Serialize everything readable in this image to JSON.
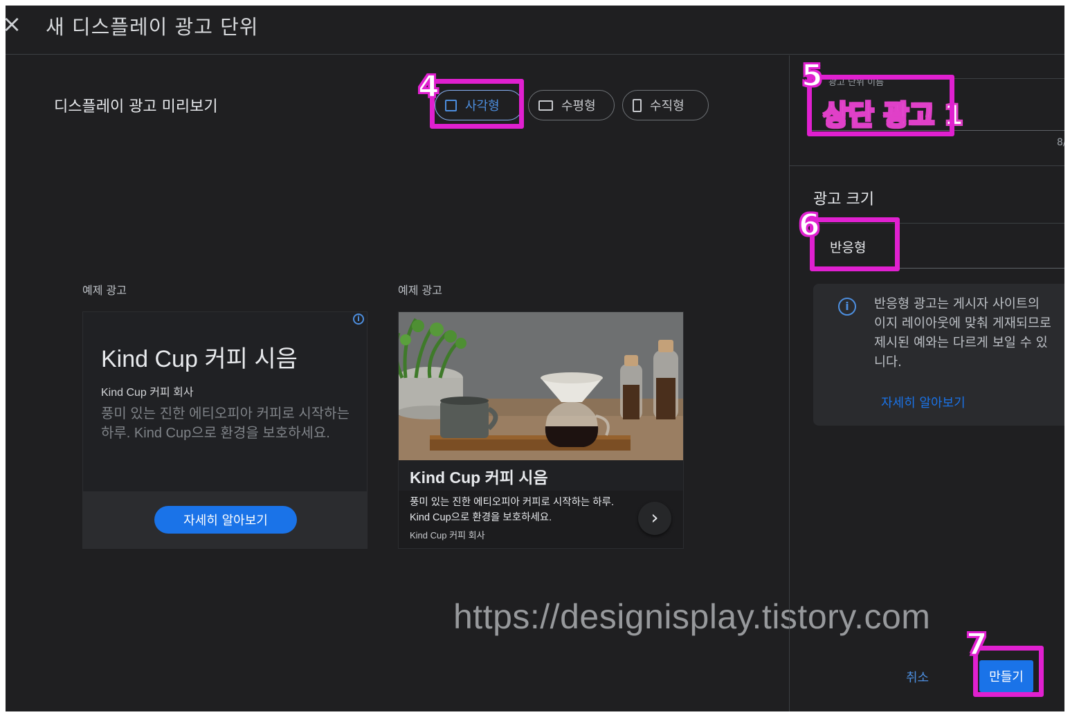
{
  "header": {
    "close_icon": "×",
    "title": "새 디스플레이 광고 단위"
  },
  "preview": {
    "title": "디스플레이 광고 미리보기",
    "shapes": [
      {
        "label": "사각형",
        "icon": "square-icon",
        "active": true
      },
      {
        "label": "수평형",
        "icon": "horizontal-rect-icon",
        "active": false
      },
      {
        "label": "수직형",
        "icon": "vertical-rect-icon",
        "active": false
      }
    ],
    "sample_label": "예제 광고",
    "ad_text": {
      "headline": "Kind Cup 커피 시음",
      "company": "Kind Cup 커피 회사",
      "description": "풍미 있는 진한 에티오피아 커피로 시작하는 하루. Kind Cup으로 환경을 보호하세요.",
      "cta": "자세히 알아보기",
      "adchoices_icon": "i"
    },
    "ad_image": {
      "arrow": "›"
    }
  },
  "settings": {
    "name_label": "광고 단위 이름",
    "name_value": "상단 광고 1",
    "name_counter": "8/",
    "size_title": "광고 크기",
    "size_value": "반응형",
    "info_icon": "i",
    "info_text": "반응형 광고는 게시자 사이트의 \n이지 레이아웃에 맞춰 게재되므로\n제시된 예와는 다르게 보일 수 있\n니다.",
    "learn_more": "자세히 알아보기",
    "cancel": "취소",
    "create": "만들기"
  },
  "watermark": "https://designisplay.tistory.com",
  "annotations": [
    "4",
    "5",
    "6",
    "7"
  ]
}
